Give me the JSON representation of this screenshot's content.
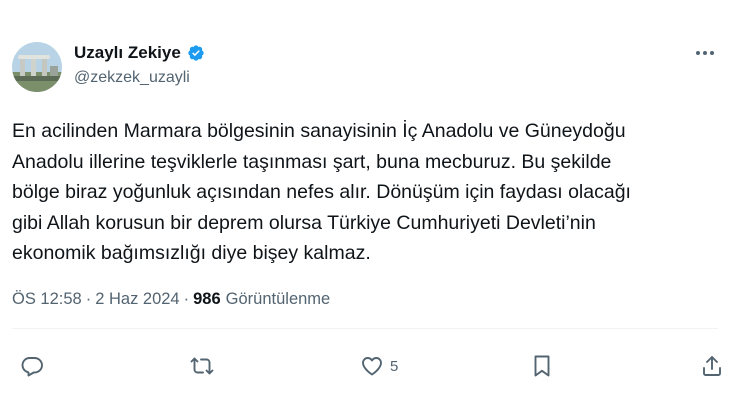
{
  "author": {
    "display_name": "Uzaylı Zekiye",
    "handle": "@zekzek_uzayli",
    "verified": true
  },
  "tweet": {
    "text": "En acilinden Marmara bölgesinin sanayisinin İç Anadolu ve Güneydoğu\nAnadolu illerine teşviklerle taşınması şart, buna mecburuz. Bu şekilde\nbölge biraz yoğunluk açısından nefes alır. Dönüşüm için faydası olacağı\ngibi Allah korusun bir deprem olursa Türkiye Cumhuriyeti Devleti’nin\nekonomik bağımsızlığı diye bişey kalmaz."
  },
  "meta": {
    "time": "ÖS 12:58",
    "separator": "·",
    "date": "2 Haz 2024",
    "views_count": "986",
    "views_label": "Görüntülenme"
  },
  "actions": {
    "reply_icon": "reply-icon",
    "retweet_icon": "retweet-icon",
    "like_icon": "heart-icon",
    "like_count": "5",
    "bookmark_icon": "bookmark-icon",
    "share_icon": "share-icon"
  },
  "colors": {
    "verified": "#1d9bf0",
    "secondary_text": "#536471",
    "primary_text": "#0f1419"
  }
}
